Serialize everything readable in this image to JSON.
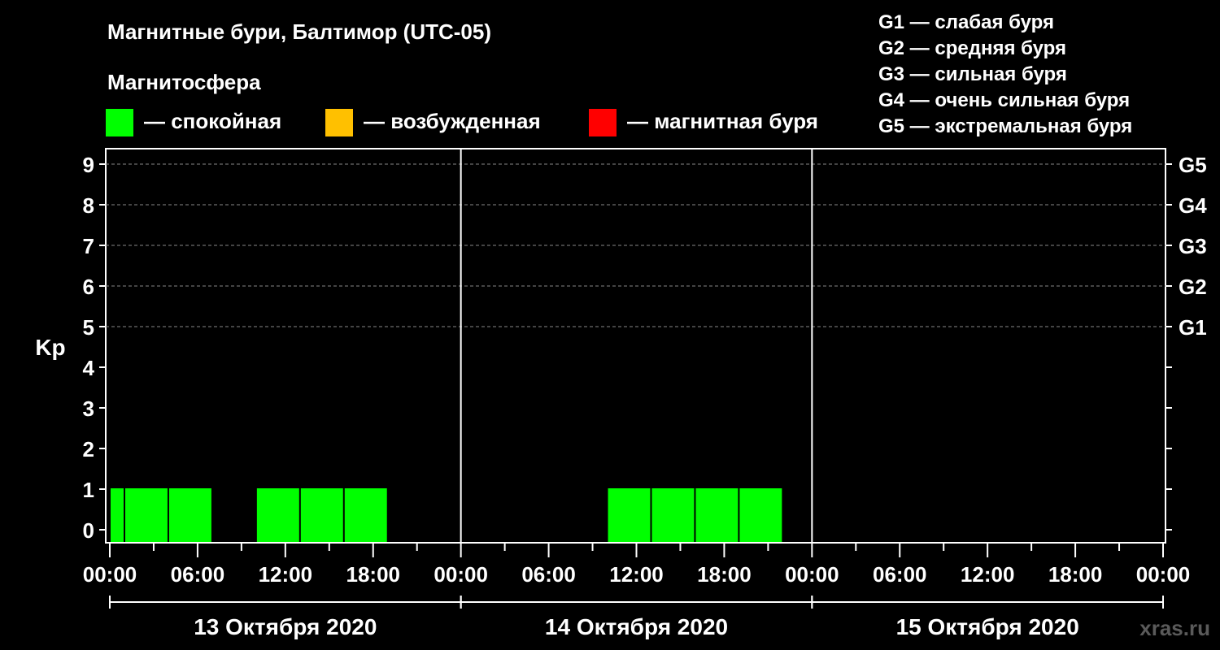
{
  "title": "Магнитные бури, Балтимор (UTC-05)",
  "magnetosphere_label": "Магнитосфера",
  "state_legend": [
    {
      "label": "— спокойная",
      "color": "#00ff00"
    },
    {
      "label": "— возбужденная",
      "color": "#ffc000"
    },
    {
      "label": "— магнитная буря",
      "color": "#ff0000"
    }
  ],
  "storm_levels": [
    "G1 — слабая буря",
    "G2 — средняя буря",
    "G3 — сильная буря",
    "G4 — очень сильная буря",
    "G5 — экстремальная буря"
  ],
  "watermark": "xras.ru",
  "chart_data": {
    "type": "bar",
    "ylabel": "Kp",
    "ylim": [
      0,
      9
    ],
    "y_ticks": [
      "0",
      "1",
      "2",
      "3",
      "4",
      "5",
      "6",
      "7",
      "8",
      "9"
    ],
    "right_ticks": [
      {
        "y": 5,
        "label": "G1"
      },
      {
        "y": 6,
        "label": "G2"
      },
      {
        "y": 7,
        "label": "G3"
      },
      {
        "y": 8,
        "label": "G4"
      },
      {
        "y": 9,
        "label": "G5"
      }
    ],
    "x_range_hours": [
      0,
      72
    ],
    "x_tick_labels": [
      {
        "hour": 0,
        "label": "00:00"
      },
      {
        "hour": 6,
        "label": "06:00"
      },
      {
        "hour": 12,
        "label": "12:00"
      },
      {
        "hour": 18,
        "label": "18:00"
      },
      {
        "hour": 24,
        "label": "00:00"
      },
      {
        "hour": 30,
        "label": "06:00"
      },
      {
        "hour": 36,
        "label": "12:00"
      },
      {
        "hour": 42,
        "label": "18:00"
      },
      {
        "hour": 48,
        "label": "00:00"
      },
      {
        "hour": 54,
        "label": "06:00"
      },
      {
        "hour": 60,
        "label": "12:00"
      },
      {
        "hour": 66,
        "label": "18:00"
      },
      {
        "hour": 72,
        "label": "00:00"
      }
    ],
    "days": [
      {
        "label": "13 Октября 2020",
        "start": 0,
        "end": 24
      },
      {
        "label": "14 Октября 2020",
        "start": 24,
        "end": 48
      },
      {
        "label": "15 Октября 2020",
        "start": 48,
        "end": 72
      }
    ],
    "series": [
      {
        "state": "спокойная",
        "color": "#00ff00",
        "bars": [
          {
            "start": 0,
            "end": 1,
            "kp": 1
          },
          {
            "start": 1,
            "end": 4,
            "kp": 1
          },
          {
            "start": 4,
            "end": 7,
            "kp": 1
          },
          {
            "start": 10,
            "end": 13,
            "kp": 1
          },
          {
            "start": 13,
            "end": 16,
            "kp": 1
          },
          {
            "start": 16,
            "end": 19,
            "kp": 1
          },
          {
            "start": 34,
            "end": 37,
            "kp": 1
          },
          {
            "start": 37,
            "end": 40,
            "kp": 1
          },
          {
            "start": 40,
            "end": 43,
            "kp": 1
          },
          {
            "start": 43,
            "end": 46,
            "kp": 1
          }
        ]
      }
    ],
    "grid": true
  }
}
